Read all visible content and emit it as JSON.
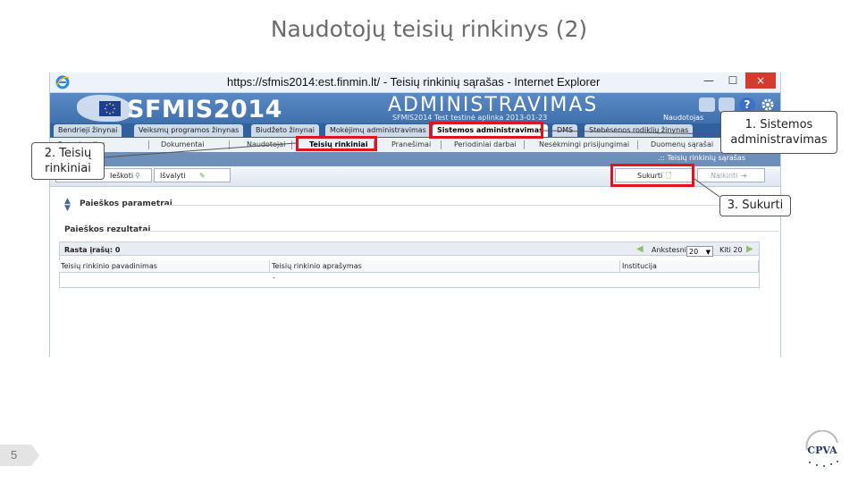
{
  "slide": {
    "title": "Naudotojų teisių rinkinys (2)",
    "page_number": "5"
  },
  "browser": {
    "url": "https://sfmis2014:est.finmin.lt/ - Teisių rinkinių sąrašas - Internet Explorer",
    "minimize": "—",
    "maximize": "☐",
    "close": "×"
  },
  "app": {
    "brand": "SFMIS2014",
    "module": "ADMINISTRAVIMAS",
    "environment": "SFMIS2014 Test testinė aplinka 2013-01-23",
    "user_label": "Naudotojas",
    "help": "?"
  },
  "main_tabs": [
    {
      "label": "Bendrieji žinynai"
    },
    {
      "label": "Veiksmų programos žinynas"
    },
    {
      "label": "Biudžeto žinynai"
    },
    {
      "label": "Mokėjimų administravimas"
    },
    {
      "label": "Sistemos administravimas"
    },
    {
      "label": "DMS"
    },
    {
      "label": "Stebėsenos rodiklių žinynas"
    }
  ],
  "sub_tabs": [
    {
      "label": "Organizacijos"
    },
    {
      "label": "Dokumentai"
    },
    {
      "label": "Naudotojai"
    },
    {
      "label": "Teisių rinkiniai"
    },
    {
      "label": "Pranešimai"
    },
    {
      "label": "Periodiniai darbai"
    },
    {
      "label": "Nesėkmingi prisijungimai"
    },
    {
      "label": "Duomenų sąrašai"
    }
  ],
  "page": {
    "section_title": ".:: Teisių rinkinių sąrašas",
    "search_button": "Ieškoti",
    "clear_button": "Išvalyti",
    "create_button": "Sukurti",
    "delete_button": "Naikinti",
    "search_params": "Paieškos parametrai",
    "search_results": "Paieškos rezultatai",
    "records_found": "Rasta įrašų: 0",
    "prev": "Ankstesni",
    "page_size": "20",
    "next": "Kiti 20",
    "columns": [
      "Teisių rinkinio pavadinimas",
      "Teisių rinkinio aprašymas",
      "Institucija"
    ],
    "empty_cell": "-"
  },
  "callouts": {
    "system_admin": "1. Sistemos administravimas",
    "rights_sets": "2. Teisių rinkiniai",
    "create": "3. Sukurti"
  },
  "logo_text": "CPVA",
  "colors": {
    "highlight": "#e3121b",
    "header_blue": "#3f70ad",
    "close_red": "#d23b2f"
  }
}
